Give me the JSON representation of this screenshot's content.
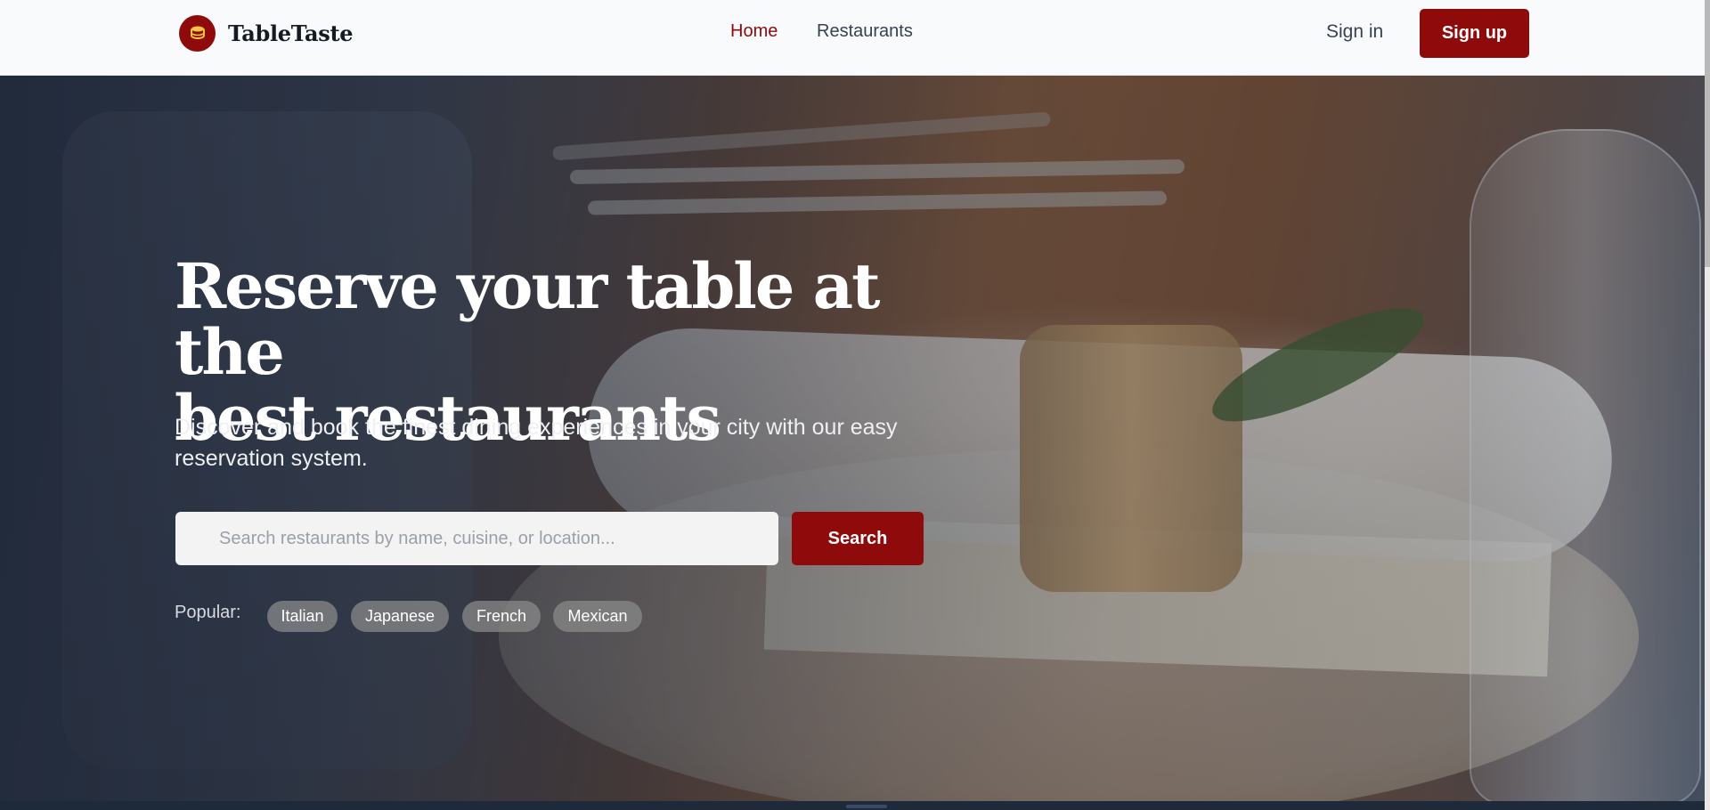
{
  "header": {
    "brand": "TableTaste",
    "nav": [
      {
        "label": "Home",
        "active": true
      },
      {
        "label": "Restaurants",
        "active": false
      }
    ],
    "sign_in": "Sign in",
    "sign_up": "Sign up"
  },
  "hero": {
    "title_line1": "Reserve your table at the",
    "title_line2": "best restaurants",
    "subtitle": "Discover and book the finest dining experiences in your city with our easy reservation system.",
    "search": {
      "placeholder": "Search restaurants by name, cuisine, or location...",
      "value": "",
      "button": "Search"
    },
    "popular_label": "Popular:",
    "popular_tags": [
      "Italian",
      "Japanese",
      "French",
      "Mexican"
    ]
  },
  "colors": {
    "accent": "#8f0b0b",
    "header_bg": "#f9fafc"
  },
  "icons": {
    "logo": "dish-icon"
  }
}
